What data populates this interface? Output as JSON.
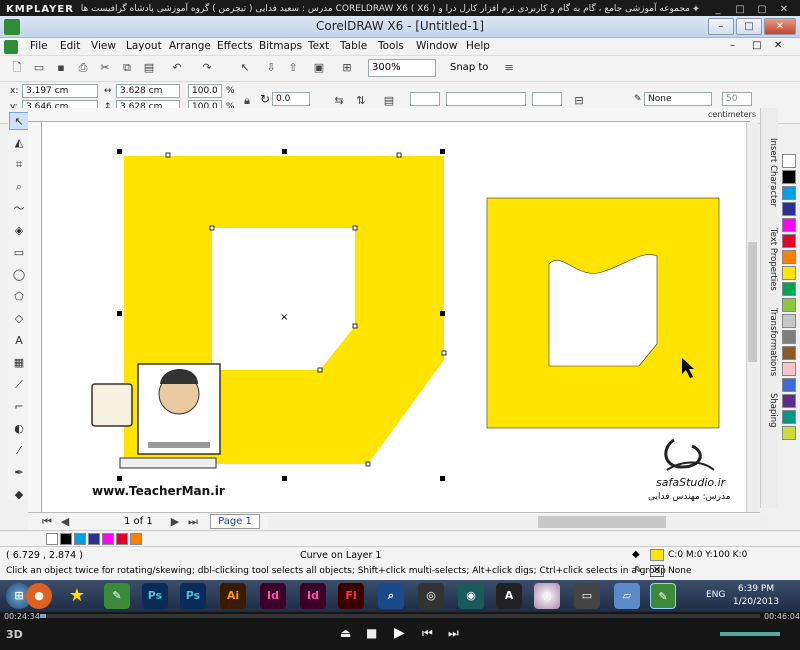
{
  "player": {
    "logo": "KMPLAYER",
    "title": "مجموعه آموزشی جامع ، گام به گام و کاربردی نرم افزار کارل درا و CORELDRAW X6  ( X6 )   مدرس : سعید فدایی ( تیچرمن ) گروه آموزشی پادشاه گرافیست ها",
    "time_elapsed": "00:24:34",
    "time_total": "00:46:04"
  },
  "window": {
    "title": "CorelDRAW X6 - [Untitled-1]"
  },
  "menu": [
    "File",
    "Edit",
    "View",
    "Layout",
    "Arrange",
    "Effects",
    "Bitmaps",
    "Text",
    "Table",
    "Tools",
    "Window",
    "Help"
  ],
  "toolbar": {
    "zoom": "300%",
    "snap": "Snap to"
  },
  "propbar": {
    "x_label": "x:",
    "x": "3.197 cm",
    "y_label": "y:",
    "y": "3.646 cm",
    "w": "3.628 cm",
    "h": "3.628 cm",
    "scale_x": "100.0",
    "scale_y": "100.0",
    "pct": "%",
    "rotation": "0.0",
    "outline": "None",
    "outline_val": "50"
  },
  "rulers": {
    "units": "centimeters"
  },
  "dockers": [
    "Insert Character",
    "Text Properties",
    "Transformations",
    "Shaping"
  ],
  "pagenav": {
    "count": "1 of 1",
    "tab": "Page 1"
  },
  "canvas": {
    "watermark_url": "www.TeacherMan.ir",
    "studio": "safaStudio.ir",
    "teacher_label": "مدرس: مهندس فدایی"
  },
  "status": {
    "coords": "( 6.729 , 2.874 )",
    "object": "Curve on Layer 1",
    "hint": "Click an object twice for rotating/skewing; dbl-clicking tool selects all objects; Shift+click multi-selects; Alt+click digs; Ctrl+click selects in a group",
    "fill": "C:0 M:0 Y:100 K:0",
    "outline": "None"
  },
  "taskbar": {
    "lang": "ENG",
    "time": "6:39 PM",
    "date": "1/20/2013"
  },
  "colors": {
    "shape_yellow": "#FFE400",
    "palette": [
      "#ffffff",
      "#000000",
      "#00a0e4",
      "#2e3192",
      "#ff00ff",
      "#e4002b",
      "#ff8000",
      "#ffe400",
      "#00a651",
      "#8dc63f",
      "#c7c7c7",
      "#7f7f7f",
      "#8b5a2b",
      "#ffc0cb",
      "#3a6bd9",
      "#5a2d8a",
      "#009688",
      "#cddc39"
    ]
  }
}
